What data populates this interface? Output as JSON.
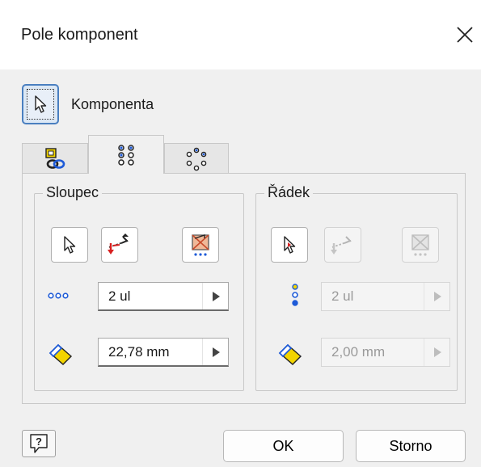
{
  "window": {
    "title": "Pole komponent",
    "close_icon": "close-icon"
  },
  "component": {
    "label": "Komponenta",
    "icon": "select-cursor-icon"
  },
  "tabs": [
    {
      "name": "assembly-tab",
      "icon": "assembly-icon",
      "selected": false
    },
    {
      "name": "rectangular-pattern-tab",
      "icon": "rectangular-pattern-icon",
      "selected": true
    },
    {
      "name": "circular-pattern-tab",
      "icon": "circular-pattern-icon",
      "selected": false
    }
  ],
  "column": {
    "title": "Sloupec",
    "count_value": "2 ul",
    "spacing_value": "22,78 mm",
    "enabled": true
  },
  "row": {
    "title": "Řádek",
    "count_value": "2 ul",
    "spacing_value": "2,00 mm",
    "enabled": false
  },
  "buttons": {
    "ok_label": "OK",
    "cancel_label": "Storno",
    "help_icon": "help-icon"
  },
  "colors": {
    "accent_blue": "#1e5bd8",
    "highlight_red": "#d82020",
    "yellow": "#f2d400",
    "background": "#f0f0f0"
  }
}
